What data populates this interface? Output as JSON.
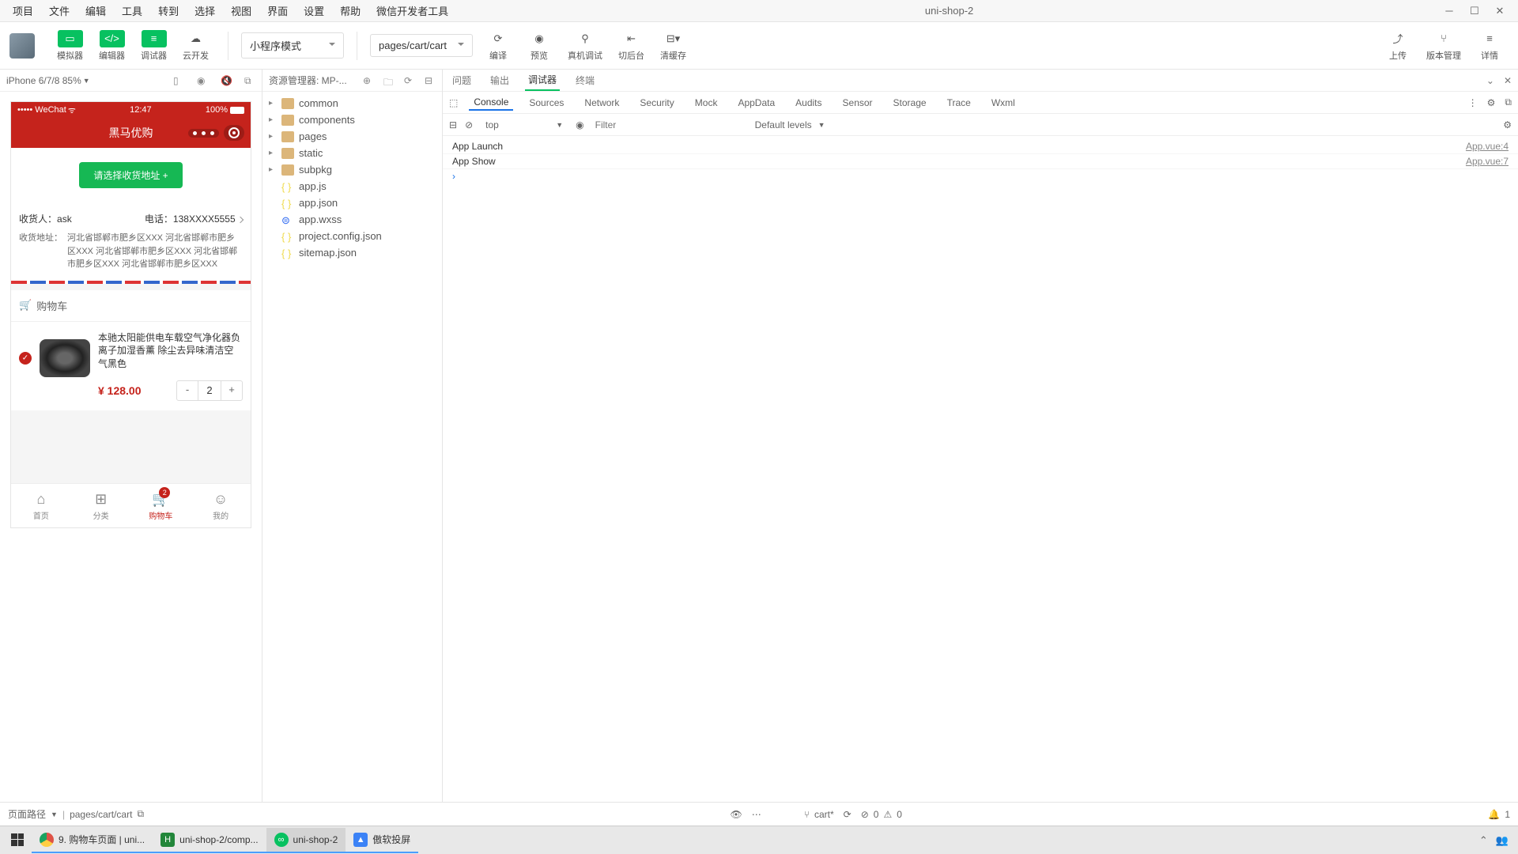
{
  "menubar": {
    "items": [
      "项目",
      "文件",
      "编辑",
      "工具",
      "转到",
      "选择",
      "视图",
      "界面",
      "设置",
      "帮助",
      "微信开发者工具"
    ],
    "title": "uni-shop-2"
  },
  "toolbar": {
    "simulator": "模拟器",
    "editor": "编辑器",
    "debugger": "调试器",
    "clouddev": "云开发",
    "mode": "小程序模式",
    "page_path": "pages/cart/cart",
    "compile": "编译",
    "preview": "预览",
    "real_device": "真机调试",
    "background": "切后台",
    "clear_cache": "清缓存",
    "upload": "上传",
    "version": "版本管理",
    "details": "详情"
  },
  "sim": {
    "device": "iPhone 6/7/8 85%",
    "status_left": "••••• WeChat",
    "status_time": "12:47",
    "status_right": "100%",
    "nav_title": "黑马优购",
    "addr_btn": "请选择收货地址 +",
    "receiver_label": "收货人：",
    "receiver_name": "ask",
    "phone_label": "电话：",
    "phone_value": "138XXXX5555",
    "addr_label": "收货地址：",
    "addr_value": "河北省邯郸市肥乡区XXX 河北省邯郸市肥乡区XXX 河北省邯郸市肥乡区XXX 河北省邯郸市肥乡区XXX 河北省邯郸市肥乡区XXX",
    "cart_header": "购物车",
    "item_title": "本驰太阳能供电车载空气净化器负离子加湿香薰 除尘去异味清洁空气黑色",
    "item_price": "¥ 128.00",
    "item_qty": "2",
    "tabs": [
      {
        "label": "首页",
        "icon": "⌂"
      },
      {
        "label": "分类",
        "icon": "⊞"
      },
      {
        "label": "购物车",
        "icon": "🛒",
        "badge": "2"
      },
      {
        "label": "我的",
        "icon": "☺"
      }
    ]
  },
  "explorer": {
    "title": "资源管理器: MP-...",
    "tree": [
      {
        "type": "folder",
        "name": "common"
      },
      {
        "type": "folder",
        "name": "components"
      },
      {
        "type": "folder",
        "name": "pages"
      },
      {
        "type": "folder",
        "name": "static"
      },
      {
        "type": "folder",
        "name": "subpkg"
      },
      {
        "type": "file",
        "name": "app.js",
        "ext": "js"
      },
      {
        "type": "file",
        "name": "app.json",
        "ext": "json"
      },
      {
        "type": "file",
        "name": "app.wxss",
        "ext": "wxss"
      },
      {
        "type": "file",
        "name": "project.config.json",
        "ext": "json"
      },
      {
        "type": "file",
        "name": "sitemap.json",
        "ext": "json"
      }
    ]
  },
  "devtools": {
    "tabs": [
      "问题",
      "输出",
      "调试器",
      "终端"
    ],
    "active_tab": "调试器",
    "subtabs": [
      "Console",
      "Sources",
      "Network",
      "Security",
      "Mock",
      "AppData",
      "Audits",
      "Sensor",
      "Storage",
      "Trace",
      "Wxml"
    ],
    "active_subtab": "Console",
    "context": "top",
    "filter_placeholder": "Filter",
    "levels": "Default levels",
    "console": [
      {
        "msg": "App Launch",
        "src": "App.vue:4"
      },
      {
        "msg": "App Show",
        "src": "App.vue:7"
      }
    ]
  },
  "status": {
    "path_label": "页面路径",
    "path": "pages/cart/cart",
    "file": "cart*",
    "errors": "0",
    "warnings": "0",
    "notif": "1"
  },
  "taskbar": {
    "items": [
      {
        "label": "9. 购物车页面 | uni...",
        "color": "#de5246"
      },
      {
        "label": "uni-shop-2/comp...",
        "color": "#22863a"
      },
      {
        "label": "uni-shop-2",
        "color": "#07c160"
      },
      {
        "label": "傲软投屏",
        "color": "#3b82f6"
      }
    ]
  }
}
